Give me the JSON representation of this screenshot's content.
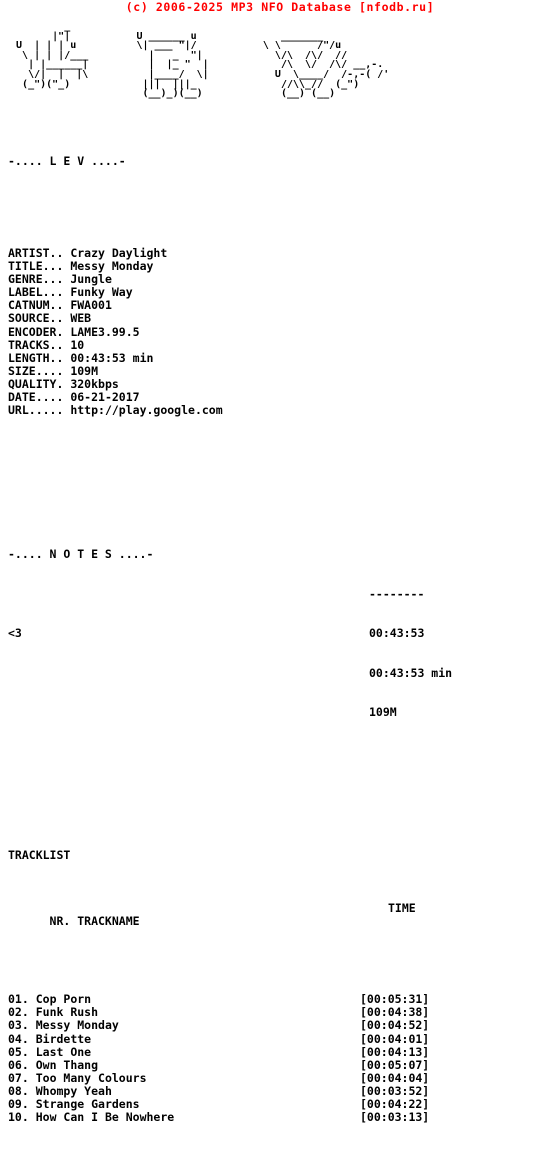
{
  "header": {
    "banner_text": "(c) 2006-2025 MP3 NFO Database [nfodb.ru]",
    "banner_color": "#ff0000"
  },
  "logo": {
    "alt": "LEV ascii art logo",
    "lines": [
      "          _                                                          ",
      "        |\"|           U ______ u              _______               ",
      "  U  | | | u          \\| ___ \"|/           \\ \\      /\"/u            ",
      "   \\ | | |/___          |   _  \"|            \\/\\  /\\/  //            ",
      "    | |______|          |  |_ \"  |            /\\  \\/  /\\/ __,-.      ",
      "    \\/|  |  |\\          |____/  \\|           U  \\____/  /-,-( /'     ",
      "   (_\")(\"_)            |||  |||_              //\\\\_//  (_\")          ",
      "                       (__)_)(__)             (__) (__)              "
    ]
  },
  "release": {
    "section_title": "-.... L E V ....-",
    "fields": [
      {
        "label": "ARTIST..",
        "value": "Crazy Daylight"
      },
      {
        "label": "TITLE...",
        "value": "Messy Monday"
      },
      {
        "label": "GENRE...",
        "value": "Jungle"
      },
      {
        "label": "LABEL...",
        "value": "Funky Way"
      },
      {
        "label": "CATNUM..",
        "value": "FWA001"
      },
      {
        "label": "SOURCE..",
        "value": "WEB"
      },
      {
        "label": "ENCODER.",
        "value": "LAME3.99.5"
      },
      {
        "label": "TRACKS..",
        "value": "10"
      },
      {
        "label": "LENGTH..",
        "value": "00:43:53 min"
      },
      {
        "label": "SIZE....",
        "value": "109M"
      },
      {
        "label": "QUALITY.",
        "value": "320kbps"
      },
      {
        "label": "DATE....",
        "value": "06-21-2017"
      },
      {
        "label": "URL.....",
        "value": "http://play.google.com"
      }
    ]
  },
  "notes": {
    "section_title": "-.... N O T E S ....-",
    "text": "<3"
  },
  "tracklist": {
    "heading": "TRACKLIST",
    "col_nr_trackname": "NR. TRACKNAME",
    "col_time": "TIME",
    "tracks": [
      {
        "nr": "01.",
        "name": "Cop Porn",
        "time": "[00:05:31]"
      },
      {
        "nr": "02.",
        "name": "Funk Rush",
        "time": "[00:04:38]"
      },
      {
        "nr": "03.",
        "name": "Messy Monday",
        "time": "[00:04:52]"
      },
      {
        "nr": "04.",
        "name": "Birdette",
        "time": "[00:04:01]"
      },
      {
        "nr": "05.",
        "name": "Last One",
        "time": "[00:04:13]"
      },
      {
        "nr": "06.",
        "name": "Own Thang",
        "time": "[00:05:07]"
      },
      {
        "nr": "07.",
        "name": "Too Many Colours",
        "time": "[00:04:04]"
      },
      {
        "nr": "08.",
        "name": "Whompy Yeah",
        "time": "[00:03:52]"
      },
      {
        "nr": "09.",
        "name": "Strange Gardens",
        "time": "[00:04:22]"
      },
      {
        "nr": "10.",
        "name": "How Can I Be Nowhere",
        "time": "[00:03:13]"
      }
    ]
  },
  "totals": {
    "rule": "--------",
    "total_time": "00:43:53",
    "total_length": "00:43:53 min",
    "total_size": "109M"
  }
}
